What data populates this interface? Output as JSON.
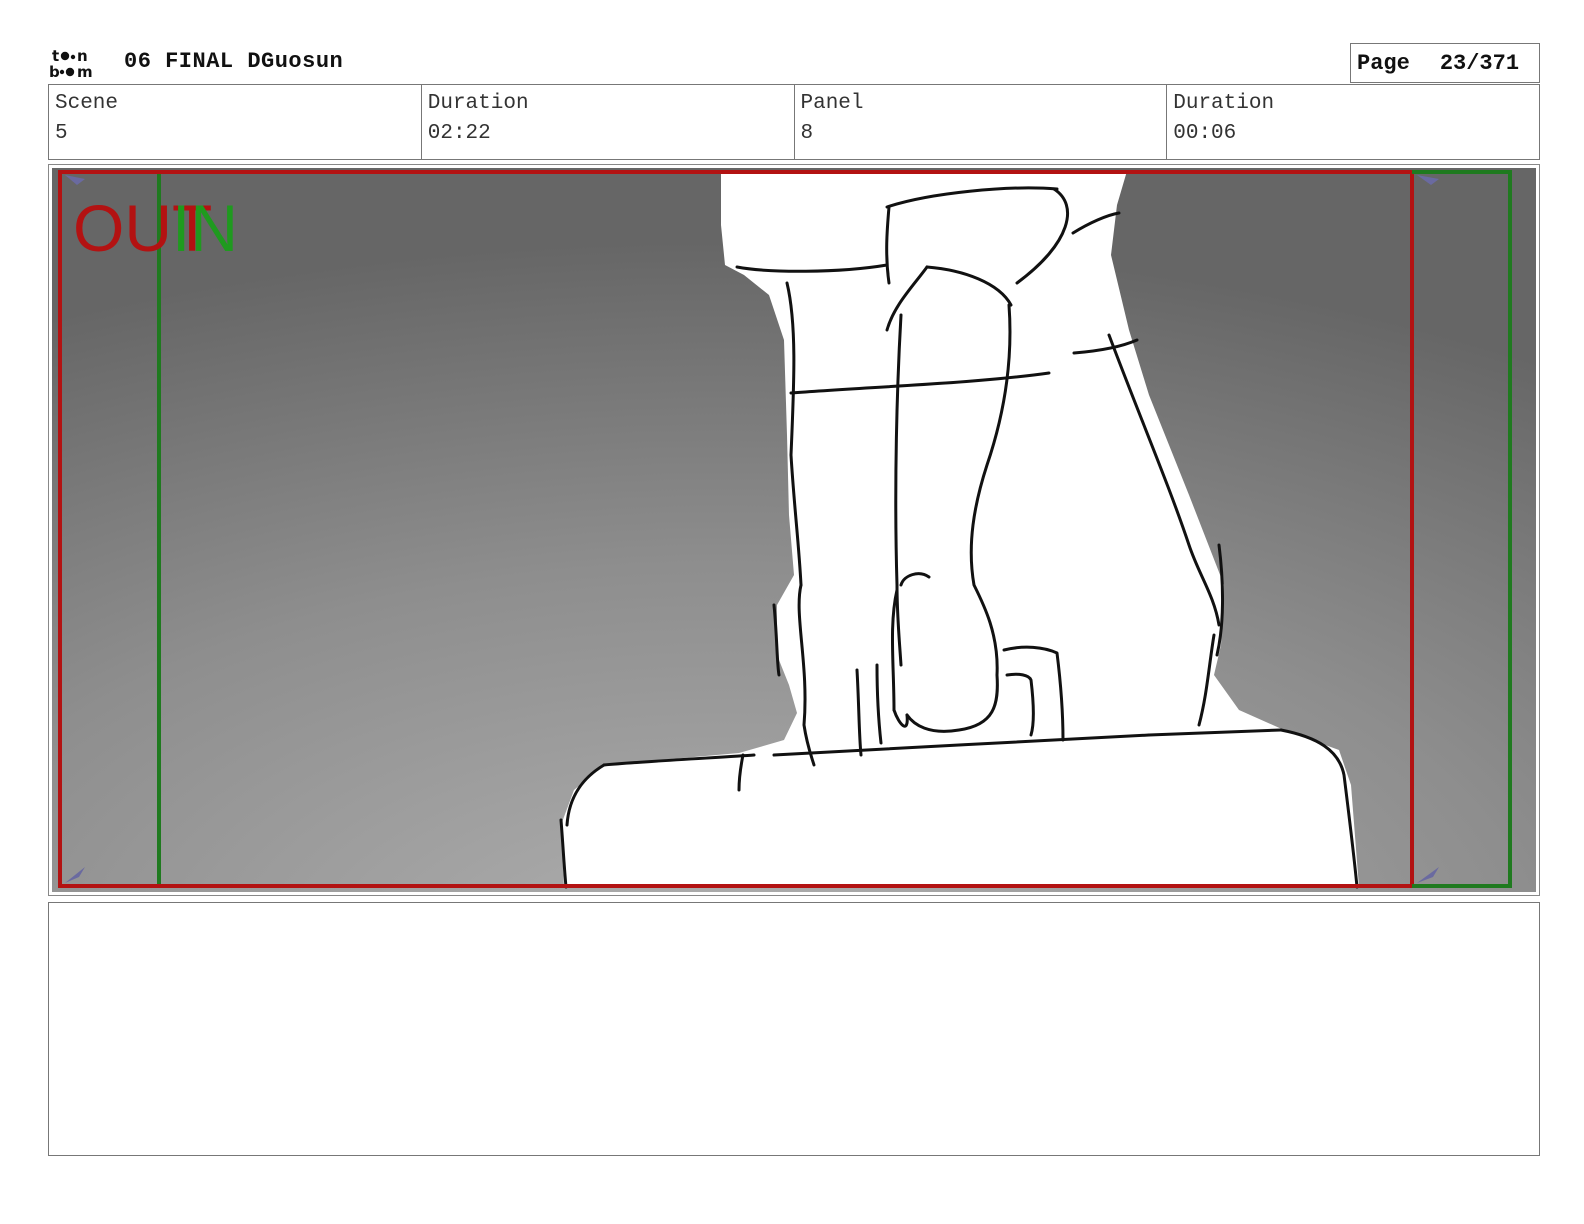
{
  "header": {
    "project_title": "06 FINAL DGuosun",
    "page_label": "Page",
    "page_value": "23/371"
  },
  "info": {
    "scene_label": "Scene",
    "scene_value": "5",
    "scene_duration_label": "Duration",
    "scene_duration_value": "02:22",
    "panel_label": "Panel",
    "panel_value": "8",
    "panel_duration_label": "Duration",
    "panel_duration_value": "00:06"
  },
  "panel": {
    "out_marker": "OUT",
    "in_marker": "IN",
    "colors": {
      "out_frame": "#b31212",
      "in_frame": "#1f7a1f",
      "background_dark": "#6a6a6a",
      "background_light": "#a8a8a8"
    }
  },
  "notes": {
    "text": ""
  }
}
